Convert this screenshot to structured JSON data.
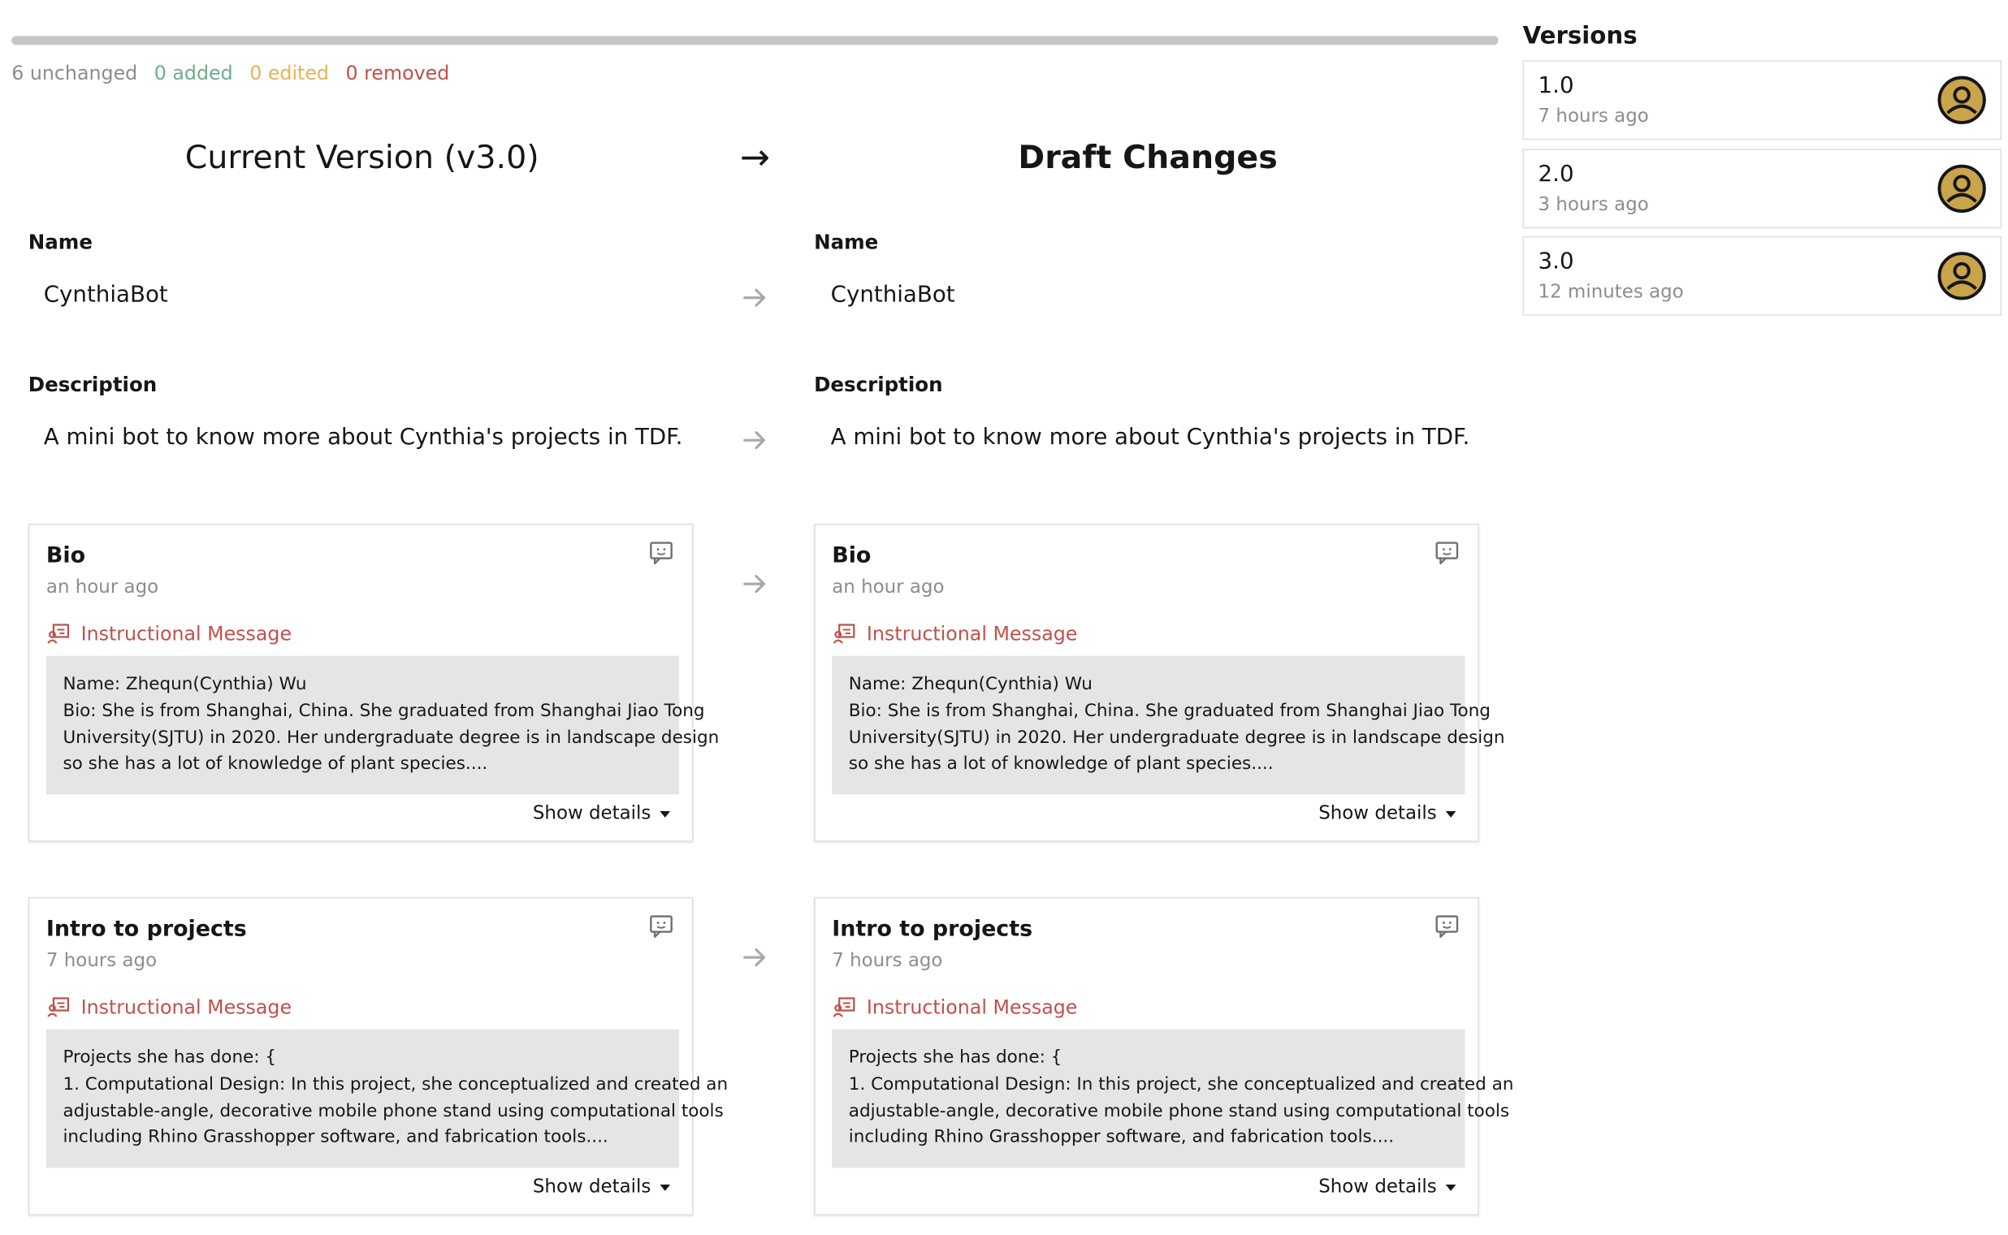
{
  "summary": {
    "unchanged": "6 unchanged",
    "added": "0 added",
    "edited": "0 edited",
    "removed": "0 removed"
  },
  "columns": {
    "current_title": "Current Version (v3.0)",
    "draft_title": "Draft Changes",
    "arrow": "→"
  },
  "fields": {
    "name_label": "Name",
    "name_value_current": "CynthiaBot",
    "name_value_draft": "CynthiaBot",
    "description_label": "Description",
    "description_value_current": "A mini bot to know more about Cynthia's projects in TDF.",
    "description_value_draft": "A mini bot to know more about Cynthia's projects in TDF."
  },
  "cards": [
    {
      "title": "Bio",
      "time": "an hour ago",
      "type_label": "Instructional Message",
      "lines": [
        "Name: Zhequn(Cynthia) Wu",
        "Bio: She is from Shanghai, China. She graduated from Shanghai Jiao Tong",
        "University(SJTU) in 2020. Her undergraduate degree is in landscape design",
        "so she has a lot of knowledge of plant species...."
      ],
      "show_details": "Show details"
    },
    {
      "title": "Intro to projects",
      "time": "7 hours ago",
      "type_label": "Instructional Message",
      "lines": [
        "Projects she has done: {",
        "1. Computational Design: In this project, she conceptualized and created an",
        "adjustable-angle, decorative mobile phone stand using computational tools",
        "including Rhino Grasshopper software, and fabrication tools...."
      ],
      "show_details": "Show details"
    }
  ],
  "versions": {
    "title": "Versions",
    "items": [
      {
        "version": "1.0",
        "time": "7 hours ago"
      },
      {
        "version": "2.0",
        "time": "3 hours ago"
      },
      {
        "version": "3.0",
        "time": "12 minutes ago"
      }
    ]
  },
  "colors": {
    "accent_red": "#c0504d",
    "added_green": "#6fac8e",
    "edited_orange": "#e8b25a",
    "avatar_gold": "#c9a44a",
    "muted_text": "#8d8d8d"
  },
  "icons": {
    "comment": "comment-icon",
    "instructional_message": "instruction-icon",
    "avatar": "user-avatar-icon",
    "row_arrow": "arrow-right-icon",
    "caret": "caret-down-icon"
  }
}
